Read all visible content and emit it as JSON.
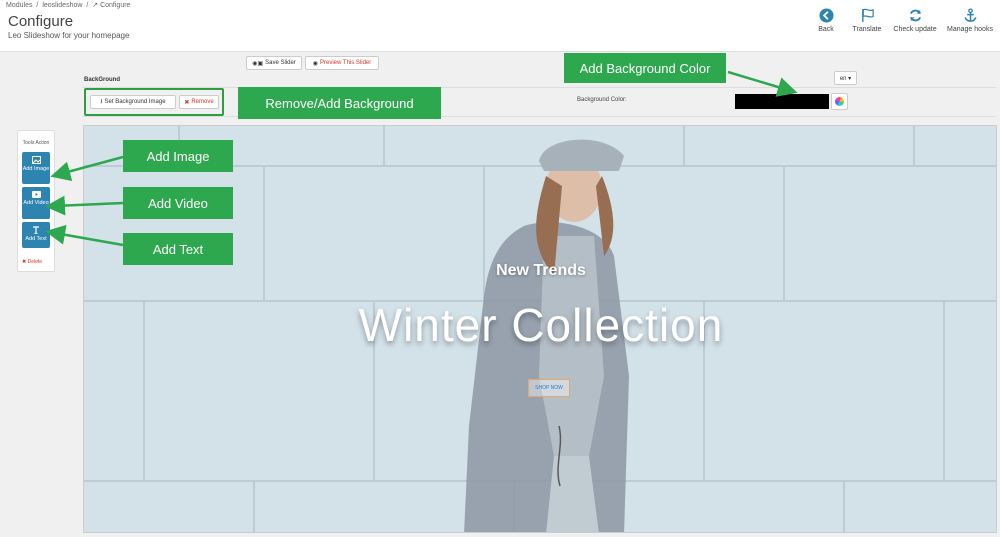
{
  "breadcrumb": [
    "Modules",
    "/",
    "leoslideshow",
    "/",
    "↗ Configure"
  ],
  "page": {
    "title": "Configure",
    "subtitle": "Leo Slideshow for your homepage"
  },
  "toolbar": {
    "back": "Back",
    "translate": "Translate",
    "check_update": "Check update",
    "manage_hooks": "Manage hooks"
  },
  "actions": {
    "save": "Save Slider",
    "preview": "Preview This Slider",
    "background_label": "BackGround",
    "set_background": "Set Background Image",
    "remove": "Remove",
    "background_color_label": "Background Color:",
    "language": "en ▾"
  },
  "colors": {
    "background_color": "#000000",
    "accent_blue": "#2e84b0",
    "callout_green": "#2ea84f"
  },
  "tools": {
    "title": "Tools Action",
    "add_image": "Add Image",
    "add_video": "Add Video",
    "add_text": "Add Text",
    "delete": "Delete"
  },
  "slide": {
    "tagline": "New Trends",
    "headline": "Winter Collection",
    "cta": "SHOP NOW"
  },
  "annotations": {
    "add_background_color": "Add Background Color",
    "remove_add_background": "Remove/Add Background",
    "add_image": "Add Image",
    "add_video": "Add Video",
    "add_text": "Add Text"
  }
}
